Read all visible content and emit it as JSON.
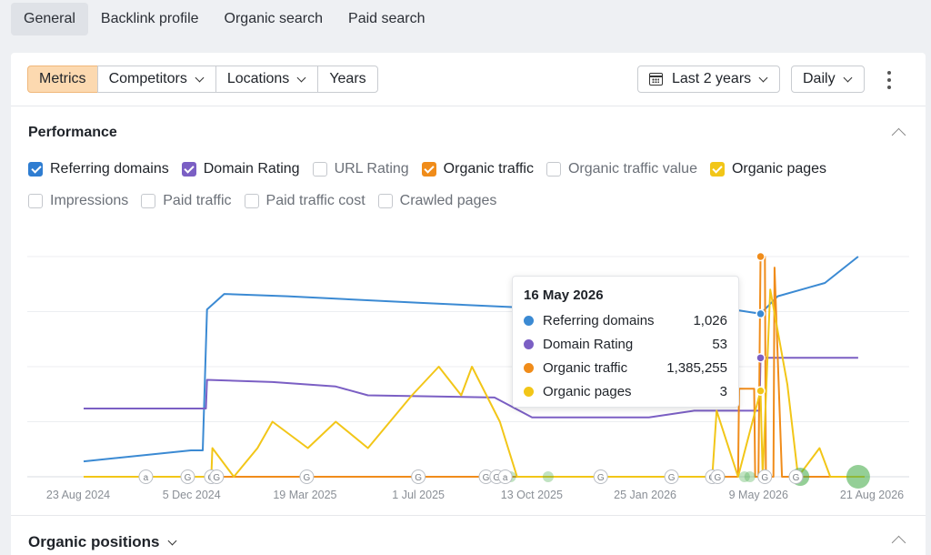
{
  "nav": {
    "tabs": [
      {
        "label": "General",
        "active": true
      },
      {
        "label": "Backlink profile"
      },
      {
        "label": "Organic search"
      },
      {
        "label": "Paid search"
      }
    ]
  },
  "toolbar": {
    "metrics": "Metrics",
    "competitors": "Competitors",
    "locations": "Locations",
    "years": "Years",
    "date_range": "Last 2 years",
    "granularity": "Daily"
  },
  "performance": {
    "title": "Performance",
    "checkboxes": [
      {
        "label": "Referring domains",
        "checked": true,
        "color": "#2f7dd1"
      },
      {
        "label": "Domain Rating",
        "checked": true,
        "color": "#7b5fc4"
      },
      {
        "label": "URL Rating",
        "checked": false
      },
      {
        "label": "Organic traffic",
        "checked": true,
        "color": "#f08c1a"
      },
      {
        "label": "Organic traffic value",
        "checked": false
      },
      {
        "label": "Organic pages",
        "checked": true,
        "color": "#f2c618"
      },
      {
        "label": "Impressions",
        "checked": false
      },
      {
        "label": "Paid traffic",
        "checked": false
      },
      {
        "label": "Paid traffic cost",
        "checked": false
      },
      {
        "label": "Crawled pages",
        "checked": false
      }
    ]
  },
  "tooltip": {
    "date": "16 May 2026",
    "rows": [
      {
        "name": "Referring domains",
        "value": "1,026",
        "color": "#3b8ad3"
      },
      {
        "name": "Domain Rating",
        "value": "53",
        "color": "#7b5fc4"
      },
      {
        "name": "Organic traffic",
        "value": "1,385,255",
        "color": "#f08c1a"
      },
      {
        "name": "Organic pages",
        "value": "3",
        "color": "#f2c618"
      }
    ]
  },
  "chart_data": {
    "type": "line",
    "x_tick_labels": [
      "23 Aug 2024",
      "5 Dec 2024",
      "19 Mar 2025",
      "1 Jul 2025",
      "13 Oct 2025",
      "25 Jan 2026",
      "9 May 2026",
      "21 Aug 2026"
    ],
    "x_range": [
      "2024-08-23",
      "2026-08-21"
    ],
    "grid": true,
    "y_scale": "independent per series",
    "series": [
      {
        "name": "Referring domains",
        "color": "#3b8ad3",
        "points": [
          [
            "2024-08-23",
            0.07
          ],
          [
            "2024-12-01",
            0.12
          ],
          [
            "2024-12-12",
            0.12
          ],
          [
            "2024-12-16",
            0.76
          ],
          [
            "2025-01-01",
            0.83
          ],
          [
            "2025-03-01",
            0.82
          ],
          [
            "2025-07-01",
            0.79
          ],
          [
            "2025-10-01",
            0.77
          ],
          [
            "2026-01-01",
            0.77
          ],
          [
            "2026-04-20",
            0.76
          ],
          [
            "2026-05-16",
            0.74
          ],
          [
            "2026-06-01",
            0.82
          ],
          [
            "2026-07-15",
            0.88
          ],
          [
            "2026-08-15",
            1.0
          ]
        ]
      },
      {
        "name": "Domain Rating",
        "color": "#7b5fc4",
        "points": [
          [
            "2024-08-23",
            0.31
          ],
          [
            "2024-12-15",
            0.31
          ],
          [
            "2024-12-16",
            0.44
          ],
          [
            "2025-02-15",
            0.43
          ],
          [
            "2025-04-15",
            0.41
          ],
          [
            "2025-05-15",
            0.37
          ],
          [
            "2025-09-10",
            0.36
          ],
          [
            "2025-10-15",
            0.27
          ],
          [
            "2026-02-01",
            0.27
          ],
          [
            "2026-03-15",
            0.3
          ],
          [
            "2026-05-15",
            0.3
          ],
          [
            "2026-05-16",
            0.54
          ],
          [
            "2026-08-15",
            0.54
          ]
        ]
      },
      {
        "name": "Organic traffic",
        "color": "#f08c1a",
        "points": [
          [
            "2024-08-23",
            0.0
          ],
          [
            "2026-04-25",
            0.0
          ],
          [
            "2026-04-26",
            0.4
          ],
          [
            "2026-05-10",
            0.4
          ],
          [
            "2026-05-11",
            0.0
          ],
          [
            "2026-05-14",
            0.0
          ],
          [
            "2026-05-16",
            1.0
          ],
          [
            "2026-05-20",
            1.0
          ],
          [
            "2026-05-21",
            0.0
          ],
          [
            "2026-05-28",
            0.0
          ],
          [
            "2026-05-29",
            0.95
          ],
          [
            "2026-06-05",
            0.0
          ],
          [
            "2026-08-21",
            0.0
          ]
        ]
      },
      {
        "name": "Organic pages",
        "color": "#f2c618",
        "points": [
          [
            "2024-08-23",
            0.0
          ],
          [
            "2024-12-20",
            0.0
          ],
          [
            "2024-12-21",
            0.13
          ],
          [
            "2025-01-10",
            0.0
          ],
          [
            "2025-02-01",
            0.13
          ],
          [
            "2025-02-15",
            0.25
          ],
          [
            "2025-03-20",
            0.13
          ],
          [
            "2025-04-15",
            0.25
          ],
          [
            "2025-05-15",
            0.13
          ],
          [
            "2025-06-25",
            0.37
          ],
          [
            "2025-07-20",
            0.5
          ],
          [
            "2025-08-10",
            0.37
          ],
          [
            "2025-08-20",
            0.5
          ],
          [
            "2025-09-15",
            0.25
          ],
          [
            "2025-10-01",
            0.0
          ],
          [
            "2026-04-01",
            0.0
          ],
          [
            "2026-04-05",
            0.3
          ],
          [
            "2026-04-25",
            0.0
          ],
          [
            "2026-05-16",
            0.39
          ],
          [
            "2026-05-18",
            0.0
          ],
          [
            "2026-05-25",
            0.85
          ],
          [
            "2026-06-10",
            0.42
          ],
          [
            "2026-06-20",
            0.0
          ],
          [
            "2026-07-10",
            0.13
          ],
          [
            "2026-07-20",
            0.0
          ],
          [
            "2026-08-21",
            0.0
          ]
        ]
      }
    ],
    "markers": [
      {
        "date": "2024-10-20",
        "label": "a"
      },
      {
        "date": "2024-11-28",
        "label": "G"
      },
      {
        "date": "2024-12-20",
        "label": "G"
      },
      {
        "date": "2024-12-25",
        "label": "G"
      },
      {
        "date": "2025-03-19",
        "label": "G"
      },
      {
        "date": "2025-07-01",
        "label": "G"
      },
      {
        "date": "2025-09-02",
        "label": "G"
      },
      {
        "date": "2025-09-12",
        "label": "G"
      },
      {
        "date": "2025-09-20",
        "label": "a"
      },
      {
        "date": "2025-12-18",
        "label": "G"
      },
      {
        "date": "2026-02-22",
        "label": "G"
      },
      {
        "date": "2026-04-01",
        "label": "G"
      },
      {
        "date": "2026-04-06",
        "label": "G"
      },
      {
        "date": "2026-05-20",
        "label": "G"
      },
      {
        "date": "2026-06-18",
        "label": "G"
      }
    ],
    "events": [
      {
        "date": "2025-09-25",
        "size": 1
      },
      {
        "date": "2025-10-30",
        "size": 1
      },
      {
        "date": "2026-04-08",
        "size": 1
      },
      {
        "date": "2026-05-01",
        "size": 1
      },
      {
        "date": "2026-05-06",
        "size": 1
      },
      {
        "date": "2026-06-22",
        "size": 2
      },
      {
        "date": "2026-08-15",
        "size": 3
      }
    ]
  },
  "organic_positions": {
    "title": "Organic positions"
  }
}
